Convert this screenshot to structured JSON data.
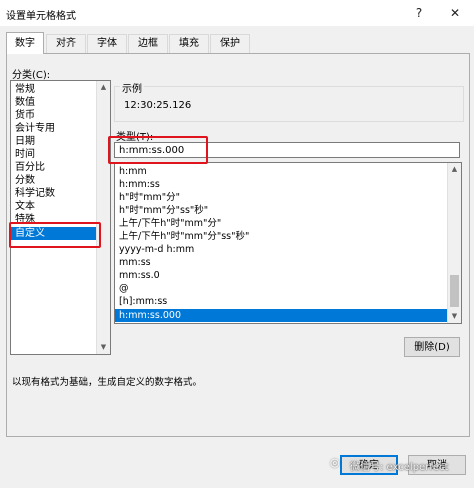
{
  "window": {
    "title": "设置单元格格式",
    "help_label": "?",
    "close_label": "✕"
  },
  "tabs": [
    {
      "label": "数字",
      "active": true
    },
    {
      "label": "对齐"
    },
    {
      "label": "字体"
    },
    {
      "label": "边框"
    },
    {
      "label": "填充"
    },
    {
      "label": "保护"
    }
  ],
  "category": {
    "label": "分类(C):",
    "items": [
      "常规",
      "数值",
      "货币",
      "会计专用",
      "日期",
      "时间",
      "百分比",
      "分数",
      "科学记数",
      "文本",
      "特殊",
      "自定义"
    ],
    "selected": "自定义"
  },
  "sample": {
    "title": "示例",
    "value": "12:30:25.126"
  },
  "type": {
    "label": "类型(T):",
    "value": "h:mm:ss.000"
  },
  "formats": {
    "items": [
      "h:mm",
      "h:mm:ss",
      "h\"时\"mm\"分\"",
      "h\"时\"mm\"分\"ss\"秒\"",
      "上午/下午h\"时\"mm\"分\"",
      "上午/下午h\"时\"mm\"分\"ss\"秒\"",
      "yyyy-m-d h:mm",
      "mm:ss",
      "mm:ss.0",
      "@",
      "[h]:mm:ss",
      "h:mm:ss.000"
    ],
    "selected": "h:mm:ss.000"
  },
  "buttons": {
    "delete": "删除(D)",
    "ok": "确定",
    "cancel": "取消"
  },
  "hint": "以现有格式为基础，生成自定义的数字格式。",
  "watermark": "微信号: excelperfect",
  "colors": {
    "selection": "#0078d7",
    "highlight": "#e0141c"
  }
}
